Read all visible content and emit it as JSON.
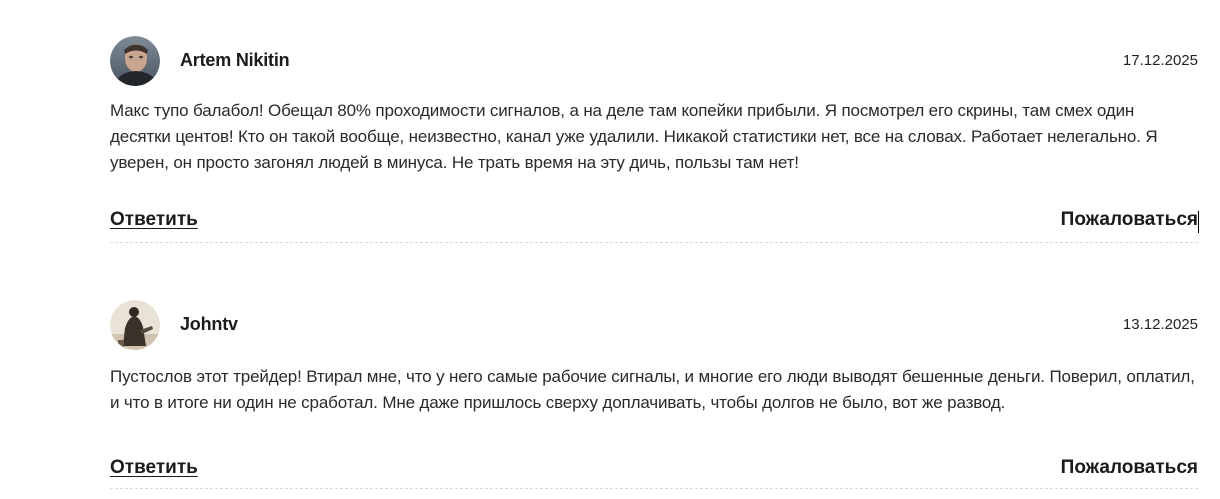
{
  "comments": [
    {
      "author": "Artem Nikitin",
      "date": "17.12.2025",
      "text": "Макс тупо балабол! Обещал 80% проходимости сигналов, а на деле там копейки прибыли. Я посмотрел его скрины, там смех один десятки центов! Кто он такой вообще, неизвестно, канал уже удалили. Никакой статистики нет, все на словах. Работает нелегально. Я уверен, он просто загонял людей в минуса. Не трать время на эту дичь, пользы там нет!",
      "reply_label": "Ответить",
      "report_label": "Пожаловаться"
    },
    {
      "author": "Johntv",
      "date": "13.12.2025",
      "text": "Пустослов этот трейдер! Втирал мне, что у него самые рабочие сигналы, и многие его люди выводят бешенные деньги. Поверил, оплатил, и что в итоге ни один не сработал. Мне даже пришлось сверху доплачивать, чтобы долгов не было, вот же развод.",
      "reply_label": "Ответить",
      "report_label": "Пожаловаться"
    }
  ]
}
